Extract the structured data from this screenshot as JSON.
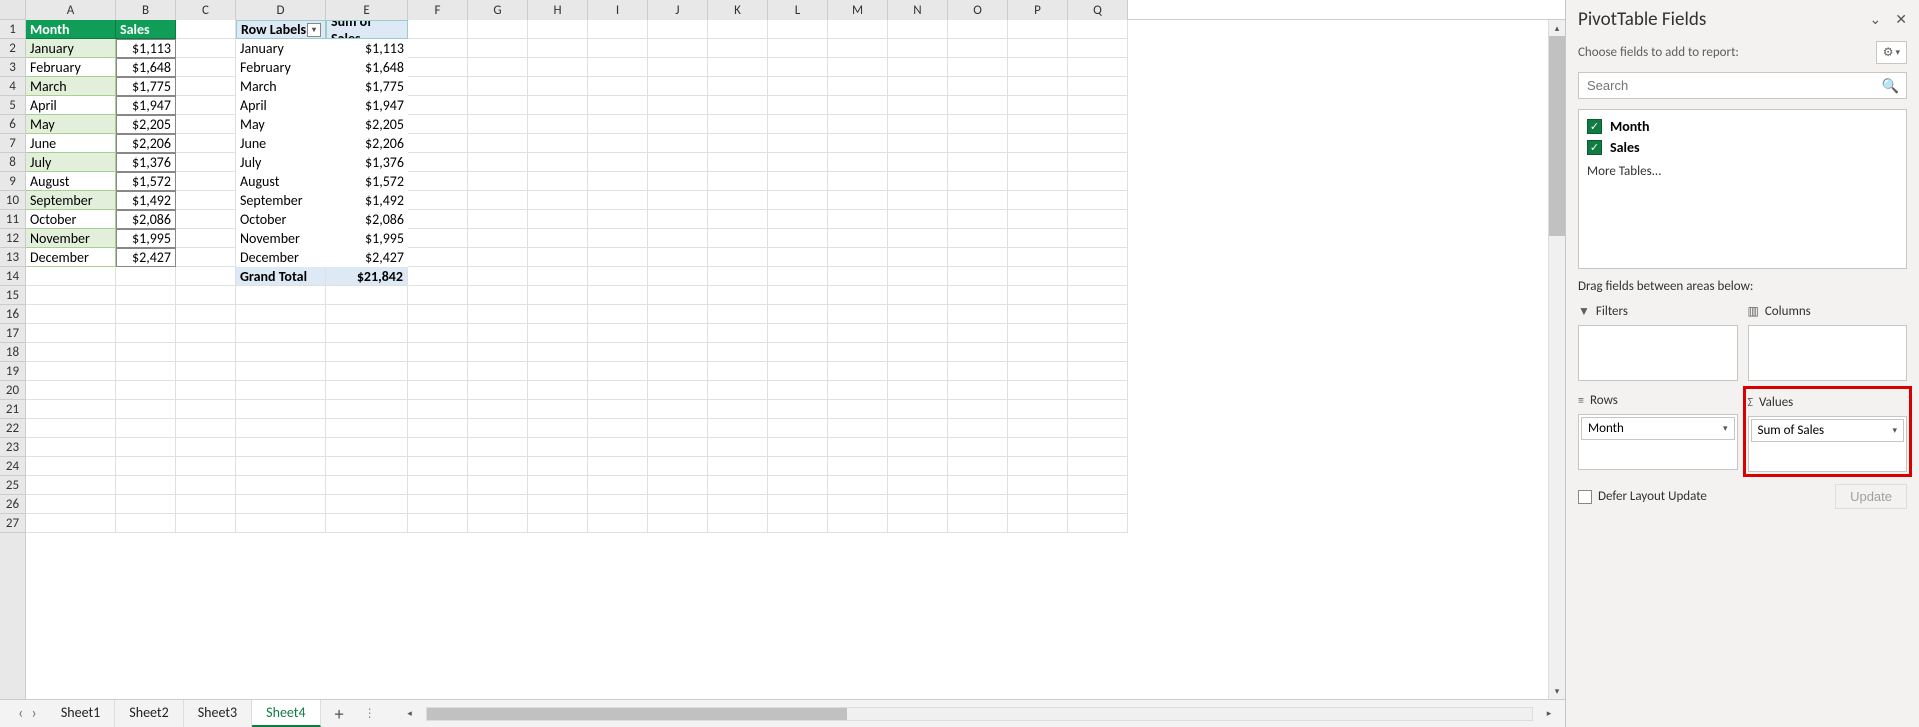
{
  "columns": [
    "A",
    "B",
    "C",
    "D",
    "E",
    "F",
    "G",
    "H",
    "I",
    "J",
    "K",
    "L",
    "M",
    "N",
    "O",
    "P",
    "Q"
  ],
  "data_table": {
    "headers": {
      "month": "Month",
      "sales": "Sales"
    },
    "rows": [
      {
        "month": "January",
        "sales": "$1,113"
      },
      {
        "month": "February",
        "sales": "$1,648"
      },
      {
        "month": "March",
        "sales": "$1,775"
      },
      {
        "month": "April",
        "sales": "$1,947"
      },
      {
        "month": "May",
        "sales": "$2,205"
      },
      {
        "month": "June",
        "sales": "$2,206"
      },
      {
        "month": "July",
        "sales": "$1,376"
      },
      {
        "month": "August",
        "sales": "$1,572"
      },
      {
        "month": "September",
        "sales": "$1,492"
      },
      {
        "month": "October",
        "sales": "$2,086"
      },
      {
        "month": "November",
        "sales": "$1,995"
      },
      {
        "month": "December",
        "sales": "$2,427"
      }
    ]
  },
  "pivot": {
    "row_labels_header": "Row Labels",
    "sum_header": "Sum of Sales",
    "rows": [
      {
        "label": "January",
        "value": "$1,113"
      },
      {
        "label": "February",
        "value": "$1,648"
      },
      {
        "label": "March",
        "value": "$1,775"
      },
      {
        "label": "April",
        "value": "$1,947"
      },
      {
        "label": "May",
        "value": "$2,205"
      },
      {
        "label": "June",
        "value": "$2,206"
      },
      {
        "label": "July",
        "value": "$1,376"
      },
      {
        "label": "August",
        "value": "$1,572"
      },
      {
        "label": "September",
        "value": "$1,492"
      },
      {
        "label": "October",
        "value": "$2,086"
      },
      {
        "label": "November",
        "value": "$1,995"
      },
      {
        "label": "December",
        "value": "$2,427"
      }
    ],
    "grand_total_label": "Grand Total",
    "grand_total_value": "$21,842"
  },
  "sheets": {
    "tabs": [
      "Sheet1",
      "Sheet2",
      "Sheet3",
      "Sheet4"
    ],
    "active_index": 3
  },
  "pane": {
    "title": "PivotTable Fields",
    "subtitle": "Choose fields to add to report:",
    "search_placeholder": "Search",
    "fields": [
      {
        "name": "Month",
        "checked": true
      },
      {
        "name": "Sales",
        "checked": true
      }
    ],
    "more_tables": "More Tables...",
    "drag_hint": "Drag fields between areas below:",
    "areas": {
      "filters": {
        "label": "Filters",
        "items": []
      },
      "columns": {
        "label": "Columns",
        "items": []
      },
      "rows": {
        "label": "Rows",
        "items": [
          "Month"
        ]
      },
      "values": {
        "label": "Values",
        "items": [
          "Sum of Sales"
        ]
      }
    },
    "defer_label": "Defer Layout Update",
    "update_label": "Update"
  }
}
